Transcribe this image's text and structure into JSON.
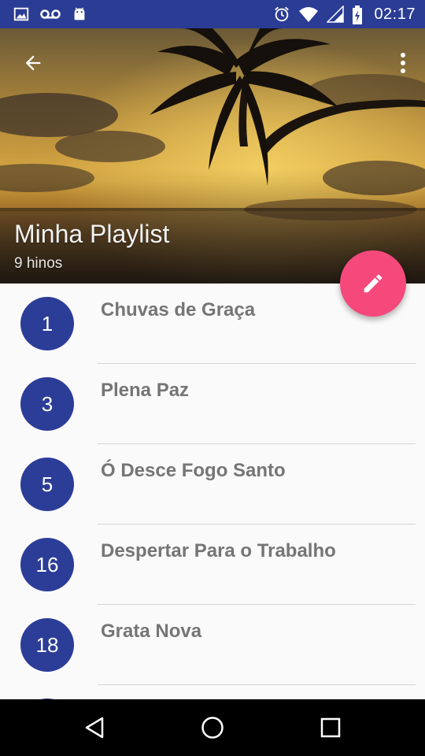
{
  "status_bar": {
    "time": "02:17",
    "left_icons": [
      "image-icon",
      "voicemail-icon",
      "android-icon"
    ],
    "right_icons": [
      "alarm-icon",
      "wifi-icon",
      "signal-icon",
      "battery-charging-icon"
    ]
  },
  "toolbar": {
    "back_icon": "arrow-back-icon",
    "menu_icon": "more-vert-icon"
  },
  "playlist": {
    "title": "Minha Playlist",
    "subtitle": "9 hinos"
  },
  "fab": {
    "icon": "edit-pencil-icon",
    "color": "#f5497c"
  },
  "hymns": [
    {
      "number": "1",
      "title": "Chuvas de Graça"
    },
    {
      "number": "3",
      "title": "Plena Paz"
    },
    {
      "number": "5",
      "title": "Ó Desce Fogo Santo"
    },
    {
      "number": "16",
      "title": "Despertar Para o Trabalho"
    },
    {
      "number": "18",
      "title": "Grata Nova"
    }
  ],
  "colors": {
    "status_bar": "#2b3c94",
    "badge": "#2c3d98",
    "accent": "#f5497c",
    "title_text": "#757575"
  },
  "navbar": {
    "icons": [
      "back-triangle-icon",
      "home-circle-icon",
      "recents-square-icon"
    ]
  }
}
